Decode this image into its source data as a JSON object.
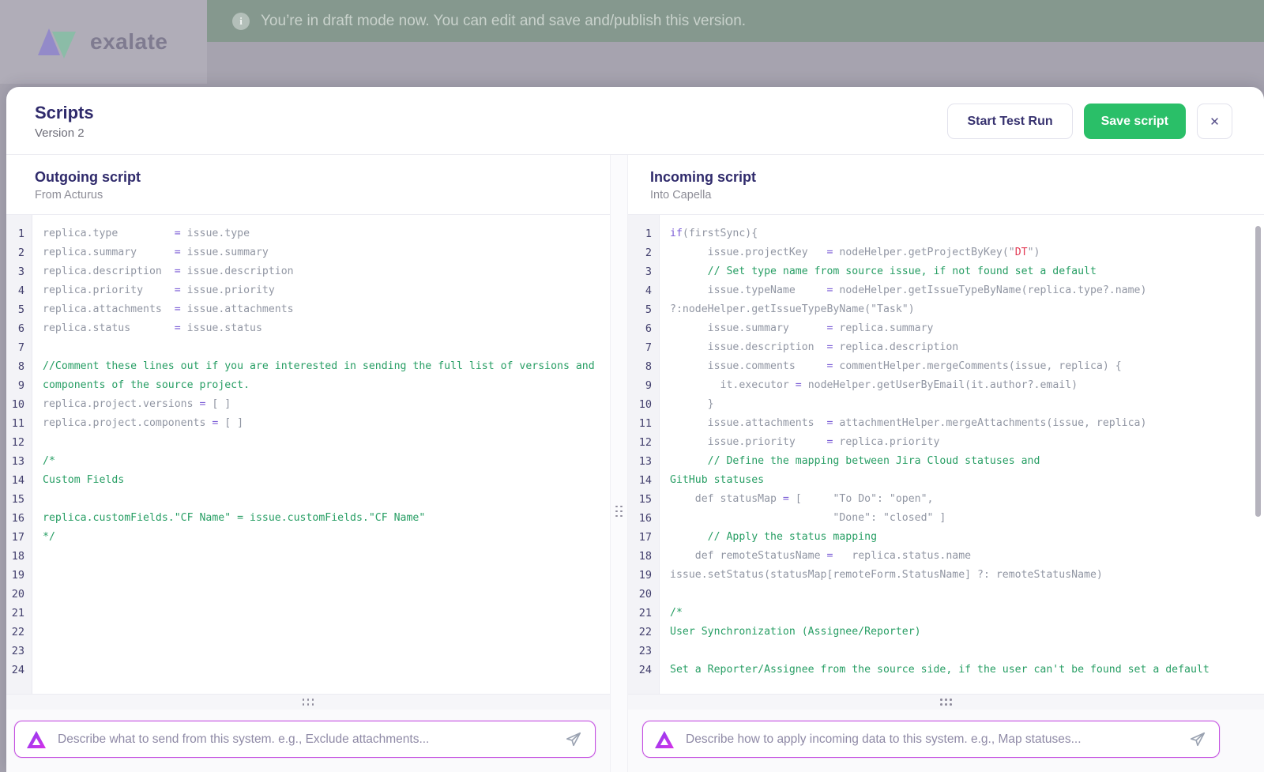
{
  "app": {
    "logo_text": "exalate",
    "banner": {
      "text": "You’re in draft mode now. You can edit and save and/publish this version."
    }
  },
  "modal": {
    "title": "Scripts",
    "version": "Version 2",
    "actions": {
      "start_test_run": "Start Test Run",
      "save_script": "Save script",
      "close": "✕"
    }
  },
  "outgoing": {
    "title": "Outgoing script",
    "subtitle": "From Acturus",
    "placeholder": "Describe what to send from this system. e.g., Exclude attachments...",
    "lines": [
      [
        [
          "replica.type         ",
          "p"
        ],
        [
          "=",
          "k"
        ],
        [
          " issue.type",
          "p"
        ]
      ],
      [
        [
          "replica.summary      ",
          "p"
        ],
        [
          "=",
          "k"
        ],
        [
          " issue.summary",
          "p"
        ]
      ],
      [
        [
          "replica.description  ",
          "p"
        ],
        [
          "=",
          "k"
        ],
        [
          " issue.description",
          "p"
        ]
      ],
      [
        [
          "replica.priority     ",
          "p"
        ],
        [
          "=",
          "k"
        ],
        [
          " issue.priority",
          "p"
        ]
      ],
      [
        [
          "replica.attachments  ",
          "p"
        ],
        [
          "=",
          "k"
        ],
        [
          " issue.attachments",
          "p"
        ]
      ],
      [
        [
          "replica.status       ",
          "p"
        ],
        [
          "=",
          "k"
        ],
        [
          " issue.status",
          "p"
        ]
      ],
      [],
      [
        [
          "//Comment these lines out if you are interested in sending the full list of versions and",
          "c"
        ]
      ],
      [
        [
          "components of the source project.",
          "c"
        ]
      ],
      [
        [
          "replica.project.versions ",
          "p"
        ],
        [
          "=",
          "k"
        ],
        [
          " [ ]",
          "p"
        ]
      ],
      [
        [
          "replica.project.components ",
          "p"
        ],
        [
          "=",
          "k"
        ],
        [
          " [ ]",
          "p"
        ]
      ],
      [],
      [
        [
          "/*",
          "c"
        ]
      ],
      [
        [
          "Custom Fields",
          "c"
        ]
      ],
      [],
      [
        [
          "replica.customFields.\"CF Name\" = issue.customFields.\"CF Name\"",
          "c"
        ]
      ],
      [
        [
          "*/",
          "c"
        ]
      ],
      [],
      [],
      [],
      [],
      [],
      [],
      []
    ]
  },
  "incoming": {
    "title": "Incoming script",
    "subtitle": "Into Capella",
    "placeholder": "Describe how to apply incoming data to this system. e.g., Map statuses...",
    "lines": [
      [
        [
          "if",
          "k"
        ],
        [
          "(firstSync){",
          "p"
        ]
      ],
      [
        [
          "      issue.projectKey   ",
          "p"
        ],
        [
          "=",
          "k"
        ],
        [
          " nodeHelper.getProjectByKey(\"",
          "p"
        ],
        [
          "DT",
          "s"
        ],
        [
          "\")",
          "p"
        ]
      ],
      [
        [
          "      // Set type name from source issue, if not found set a default",
          "c"
        ]
      ],
      [
        [
          "      issue.typeName     ",
          "p"
        ],
        [
          "=",
          "k"
        ],
        [
          " nodeHelper.getIssueTypeByName(replica.type?.name)",
          "p"
        ]
      ],
      [
        [
          "?:nodeHelper.getIssueTypeByName(\"Task\")",
          "p"
        ]
      ],
      [
        [
          "      issue.summary      ",
          "p"
        ],
        [
          "=",
          "k"
        ],
        [
          " replica.summary",
          "p"
        ]
      ],
      [
        [
          "      issue.description  ",
          "p"
        ],
        [
          "=",
          "k"
        ],
        [
          " replica.description",
          "p"
        ]
      ],
      [
        [
          "      issue.comments     ",
          "p"
        ],
        [
          "=",
          "k"
        ],
        [
          " commentHelper.mergeComments(issue, replica) {",
          "p"
        ]
      ],
      [
        [
          "        it.executor ",
          "p"
        ],
        [
          "=",
          "k"
        ],
        [
          " nodeHelper.getUserByEmail(it.author?.email)",
          "p"
        ]
      ],
      [
        [
          "      }",
          "p"
        ]
      ],
      [
        [
          "      issue.attachments  ",
          "p"
        ],
        [
          "=",
          "k"
        ],
        [
          " attachmentHelper.mergeAttachments(issue, replica)",
          "p"
        ]
      ],
      [
        [
          "      issue.priority     ",
          "p"
        ],
        [
          "=",
          "k"
        ],
        [
          " replica.priority",
          "p"
        ]
      ],
      [
        [
          "      // Define the mapping between Jira Cloud statuses and",
          "c"
        ]
      ],
      [
        [
          "GitHub statuses",
          "c"
        ]
      ],
      [
        [
          "    def statusMap ",
          "p"
        ],
        [
          "=",
          "k"
        ],
        [
          " [     \"To Do\": \"open\",",
          "p"
        ]
      ],
      [
        [
          "                          \"Done\": \"closed\" ]",
          "p"
        ]
      ],
      [
        [
          "      // Apply the status mapping",
          "c"
        ]
      ],
      [
        [
          "    def remoteStatusName ",
          "p"
        ],
        [
          "=",
          "k"
        ],
        [
          "   replica.status.name",
          "p"
        ]
      ],
      [
        [
          "issue.setStatus(statusMap[remoteForm.StatusName] ?: remoteStatusName)",
          "p"
        ]
      ],
      [],
      [
        [
          "/*",
          "c"
        ]
      ],
      [
        [
          "User Synchronization (Assignee/Reporter)",
          "c"
        ]
      ],
      [],
      [
        [
          "Set a Reporter/Assignee from the source side, if the user can't be found set a default",
          "c"
        ]
      ]
    ]
  },
  "colors": {
    "save_button_green": "#2abf68",
    "banner_green": "#85988e",
    "title_indigo": "#2f2a6b",
    "comment_green": "#279e64",
    "keyword_purple": "#7b5dd6",
    "string_red": "#e23a53",
    "prompt_border_magenta": "#c44fe1"
  },
  "icons": {
    "banner": "info-icon",
    "logo": "exalate-logo-icon",
    "close": "x-icon",
    "prompt": "ai-triangle-icon",
    "send": "paper-plane-icon",
    "divider": "drag-handle-icon"
  }
}
